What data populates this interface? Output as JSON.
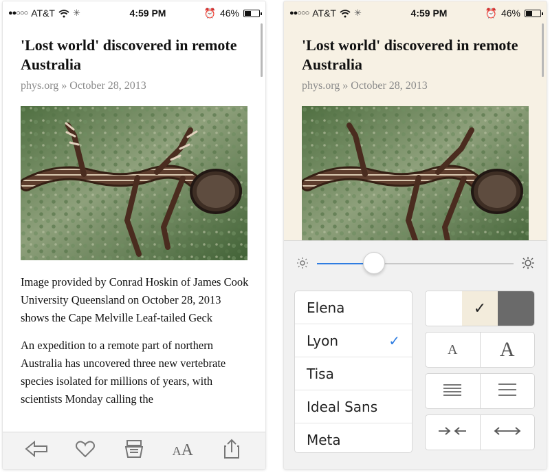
{
  "status_bar": {
    "carrier": "AT&T",
    "time": "4:59 PM",
    "battery": "46%"
  },
  "article": {
    "title": "'Lost world' discovered in remote Australia",
    "source": "phys.org » October 28, 2013",
    "caption": "Image provided by Conrad Hoskin of James Cook University Queensland on October 28, 2013 shows the Cape Melville Leaf-tailed Geck",
    "body": "An expedition to a remote part of northern Australia has uncovered three new vertebrate species isolated for millions of years, with scientists Monday calling the"
  },
  "toolbar": {
    "items": [
      {
        "name": "back-button",
        "icon": "back-arrow-icon"
      },
      {
        "name": "favorite-button",
        "icon": "heart-icon"
      },
      {
        "name": "save-button",
        "icon": "archive-icon"
      },
      {
        "name": "font-size-button",
        "icon": "font-size-icon",
        "label_small": "A",
        "label_large": "A"
      },
      {
        "name": "share-button",
        "icon": "share-icon"
      }
    ]
  },
  "settings": {
    "brightness": 0.29,
    "fonts": [
      {
        "label": "Elena",
        "selected": false
      },
      {
        "label": "Lyon",
        "selected": true
      },
      {
        "label": "Tisa",
        "selected": false
      },
      {
        "label": "Ideal Sans",
        "selected": false
      },
      {
        "label": "Meta",
        "selected": false
      }
    ],
    "selected_check": "✓",
    "theme_check": "✓",
    "font_decrease_label": "A",
    "font_increase_label": "A",
    "themes": [
      {
        "name": "white",
        "color": "#ffffff",
        "selected": false
      },
      {
        "name": "sepia",
        "color": "#f3ecdc",
        "selected": true
      },
      {
        "name": "dark",
        "color": "#6a6a6a",
        "selected": false
      }
    ]
  },
  "colors": {
    "accent": "#2f7de1",
    "sepia": "#f7f1e4",
    "text": "#111111",
    "muted": "#8a8a8a"
  }
}
